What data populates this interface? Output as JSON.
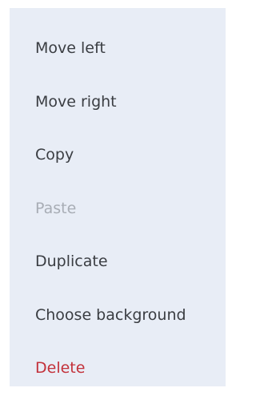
{
  "context_menu": {
    "items": [
      {
        "label": "Move left",
        "state": "enabled"
      },
      {
        "label": "Move right",
        "state": "enabled"
      },
      {
        "label": "Copy",
        "state": "enabled"
      },
      {
        "label": "Paste",
        "state": "disabled"
      },
      {
        "label": "Duplicate",
        "state": "enabled"
      },
      {
        "label": "Choose background",
        "state": "enabled"
      },
      {
        "label": "Delete",
        "state": "destructive"
      }
    ],
    "colors": {
      "background": "#e8edf6",
      "text": "#3a3d42",
      "disabled_text": "#a8adb5",
      "destructive_text": "#c3313a"
    }
  }
}
